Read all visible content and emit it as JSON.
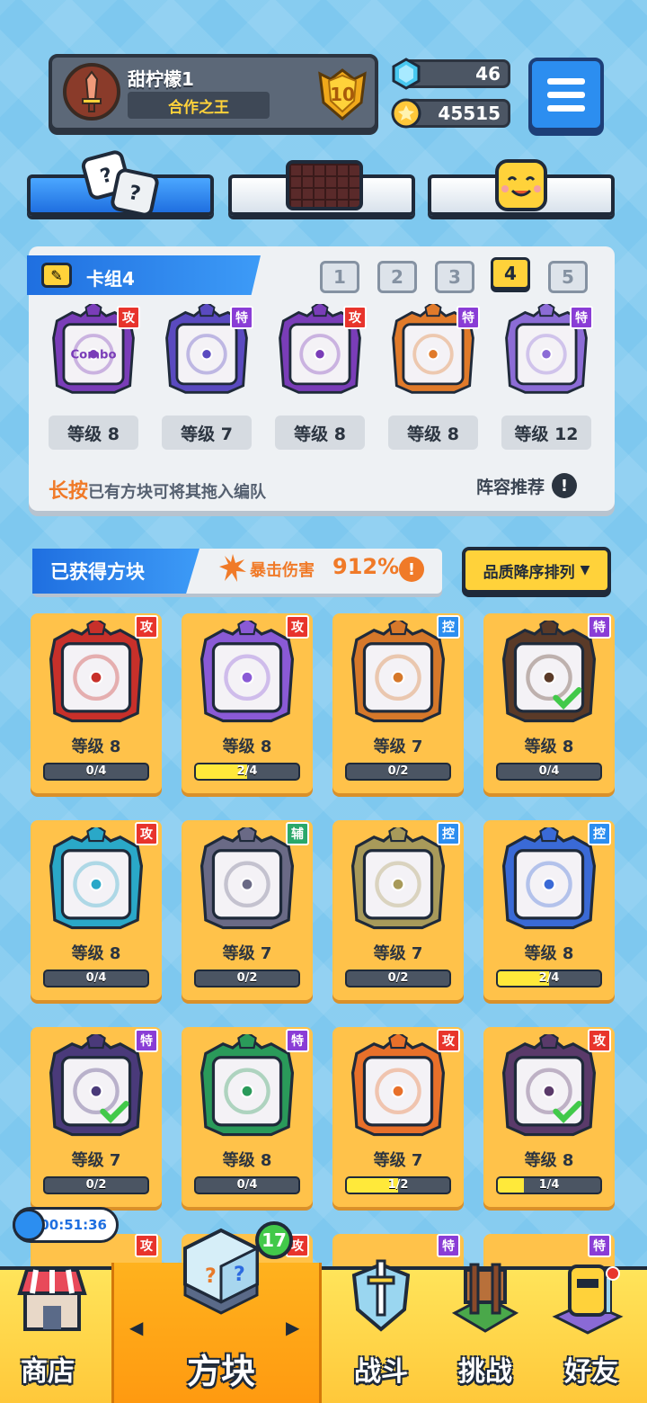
{
  "player": {
    "name": "甜柠檬1",
    "title": "合作之王",
    "rank": "10"
  },
  "resources": {
    "gems": "46",
    "coins": "45515"
  },
  "tabs": [
    "dice",
    "board",
    "emoji"
  ],
  "deck": {
    "title": "卡组4",
    "numbers": [
      "1",
      "2",
      "3",
      "4",
      "5"
    ],
    "active": "4",
    "cards": [
      {
        "tag": "攻",
        "level": "等级 8",
        "tag_color": "#e8342c",
        "frame": "#7a3db8",
        "inner": "Combo"
      },
      {
        "tag": "特",
        "level": "等级 7",
        "tag_color": "#8a3dd6",
        "frame": "#5a4ac0",
        "inner": ""
      },
      {
        "tag": "攻",
        "level": "等级 8",
        "tag_color": "#e8342c",
        "frame": "#7a3db8",
        "inner": ""
      },
      {
        "tag": "特",
        "level": "等级 8",
        "tag_color": "#8a3dd6",
        "frame": "#e07a2a",
        "inner": ""
      },
      {
        "tag": "特",
        "level": "等级 12",
        "tag_color": "#8a3dd6",
        "frame": "#8c6cd6",
        "inner": ""
      }
    ],
    "tip_highlight": "长按",
    "tip_text": "已有方块可将其拖入编队",
    "recommend": "阵容推荐"
  },
  "owned": {
    "title": "已获得方块",
    "crit_label": "暴击伤害",
    "crit_value": "912%",
    "sort_label": "品质降序排列"
  },
  "collection": [
    {
      "tag": "攻",
      "tag_color": "#e8342c",
      "frame": "#c8302a",
      "level": "等级 8",
      "progress": "0/4",
      "fill": 0,
      "check": false
    },
    {
      "tag": "攻",
      "tag_color": "#e8342c",
      "frame": "#8a5ad6",
      "level": "等级 8",
      "progress": "2/4",
      "fill": 0.5,
      "check": false
    },
    {
      "tag": "控",
      "tag_color": "#2c8ef0",
      "frame": "#d6782a",
      "level": "等级 7",
      "progress": "0/2",
      "fill": 0,
      "check": false
    },
    {
      "tag": "特",
      "tag_color": "#8a3dd6",
      "frame": "#5a3a28",
      "level": "等级 8",
      "progress": "0/4",
      "fill": 0,
      "check": true
    },
    {
      "tag": "攻",
      "tag_color": "#e8342c",
      "frame": "#2aa8c8",
      "level": "等级 8",
      "progress": "0/4",
      "fill": 0,
      "check": false
    },
    {
      "tag": "辅",
      "tag_color": "#2aa86a",
      "frame": "#6a6a86",
      "level": "等级 7",
      "progress": "0/2",
      "fill": 0,
      "check": false
    },
    {
      "tag": "控",
      "tag_color": "#2c8ef0",
      "frame": "#a89a5a",
      "level": "等级 7",
      "progress": "0/2",
      "fill": 0,
      "check": false
    },
    {
      "tag": "控",
      "tag_color": "#2c8ef0",
      "frame": "#3a6ad6",
      "level": "等级 8",
      "progress": "2/4",
      "fill": 0.5,
      "check": false
    },
    {
      "tag": "特",
      "tag_color": "#8a3dd6",
      "frame": "#4a3a7a",
      "level": "等级 7",
      "progress": "0/2",
      "fill": 0,
      "check": true
    },
    {
      "tag": "特",
      "tag_color": "#8a3dd6",
      "frame": "#2a9a5a",
      "level": "等级 8",
      "progress": "0/4",
      "fill": 0,
      "check": false
    },
    {
      "tag": "攻",
      "tag_color": "#e8342c",
      "frame": "#e8702a",
      "level": "等级 7",
      "progress": "1/2",
      "fill": 0.5,
      "check": false
    },
    {
      "tag": "攻",
      "tag_color": "#e8342c",
      "frame": "#5a3a6a",
      "level": "等级 8",
      "progress": "1/4",
      "fill": 0.25,
      "check": true
    }
  ],
  "peek_tags": [
    {
      "tag": "攻",
      "tag_color": "#e8342c"
    },
    {
      "tag": "攻",
      "tag_color": "#e8342c"
    },
    {
      "tag": "特",
      "tag_color": "#8a3dd6"
    },
    {
      "tag": "特",
      "tag_color": "#8a3dd6"
    }
  ],
  "nav": {
    "timer": "00:51:36",
    "badge": "17",
    "items": [
      "商店",
      "方块",
      "战斗",
      "挑战",
      "好友"
    ]
  }
}
